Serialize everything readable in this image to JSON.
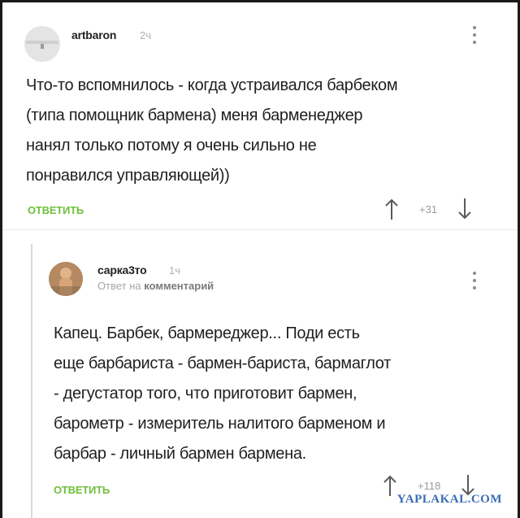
{
  "comments": [
    {
      "author": "artbaron",
      "time": "2ч",
      "text_lines": [
        "Что-то вспомнилось - когда устраивался барбеком",
        "(типа помощник бармена) меня барменеджер",
        "нанял только потому я очень сильно не",
        "понравился управляющей))"
      ],
      "reply_label": "ОТВЕТИТЬ",
      "score": "+31"
    },
    {
      "author": "сарка3то",
      "time": "1ч",
      "reply_to_prefix": "Ответ на",
      "reply_to_link": "комментарий",
      "text_lines": [
        "Капец. Барбек, бармереджер... Поди есть",
        "еще барбариста - бармен-бариста, бармаглот",
        "- дегустатор того, что приготовит бармен,",
        "барометр - измеритель налитого барменом и",
        "барбар - личный бармен бармена."
      ],
      "reply_label": "ОТВЕТИТЬ",
      "score": "+118"
    }
  ],
  "watermark": "YAPLAKAL.COM",
  "icons": {
    "upvote": "arrow-up-icon",
    "downvote": "arrow-down-icon",
    "menu": "more-vertical-icon"
  },
  "colors": {
    "accent": "#6fbf3a",
    "watermark": "#3a6bb5"
  }
}
